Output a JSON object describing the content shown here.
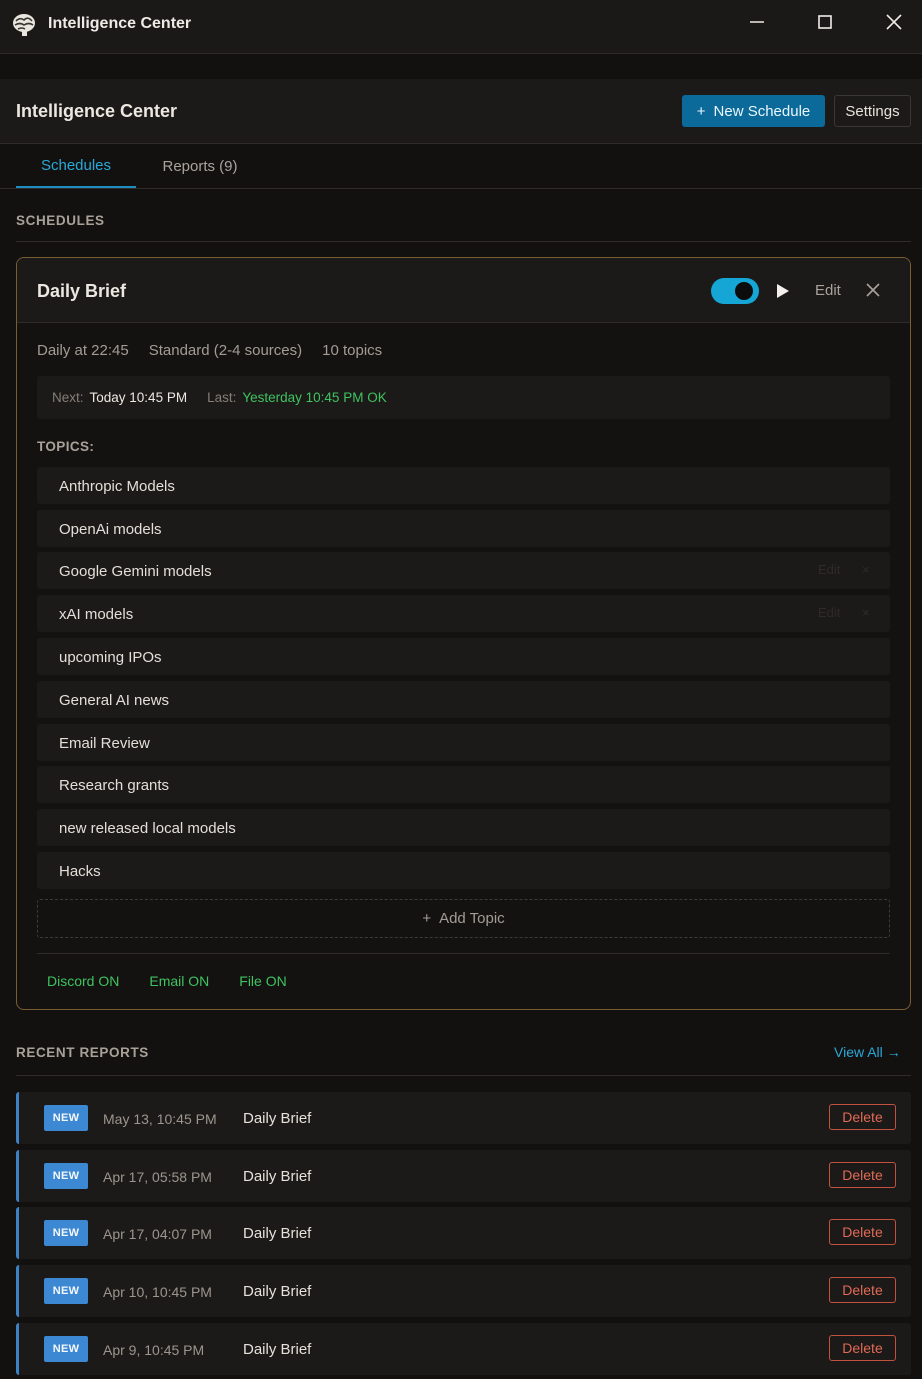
{
  "window": {
    "title": "Intelligence Center",
    "icon": "brain-icon"
  },
  "header": {
    "title": "Intelligence Center",
    "new_schedule_label": "New Schedule",
    "new_schedule_prefix": "+",
    "settings_label": "Settings"
  },
  "tabs": [
    {
      "label": "Schedules",
      "active": true
    },
    {
      "label": "Reports (9)",
      "active": false
    }
  ],
  "schedules_section": {
    "label": "SCHEDULES"
  },
  "schedule": {
    "title": "Daily Brief",
    "enabled": true,
    "edit_label": "Edit",
    "frequency": "Daily at 22:45",
    "depth": "Standard (2-4 sources)",
    "topic_count": "10 topics",
    "next_label": "Next:",
    "next_value": "Today 10:45 PM",
    "last_label": "Last:",
    "last_value": "Yesterday 10:45 PM OK",
    "topics_label": "TOPICS:",
    "topics": [
      {
        "label": "Anthropic Models"
      },
      {
        "label": "OpenAi models"
      },
      {
        "label": "Google Gemini models",
        "edit": "Edit",
        "remove": "×"
      },
      {
        "label": "xAI models",
        "edit": "Edit",
        "remove": "×"
      },
      {
        "label": "upcoming IPOs"
      },
      {
        "label": "General AI news"
      },
      {
        "label": "Email Review"
      },
      {
        "label": "Research grants"
      },
      {
        "label": "new released local models"
      },
      {
        "label": "Hacks"
      }
    ],
    "add_topic_prefix": "+",
    "add_topic_label": "Add Topic",
    "channels": [
      {
        "label": "Discord ON"
      },
      {
        "label": "Email ON"
      },
      {
        "label": "File ON"
      }
    ]
  },
  "recent_reports": {
    "label": "RECENT REPORTS",
    "view_all_label": "View All",
    "view_all_arrow": "→",
    "items": [
      {
        "badge": "NEW",
        "date": "May 13, 10:45 PM",
        "name": "Daily Brief",
        "delete_label": "Delete"
      },
      {
        "badge": "NEW",
        "date": "Apr 17, 05:58 PM",
        "name": "Daily Brief",
        "delete_label": "Delete"
      },
      {
        "badge": "NEW",
        "date": "Apr 17, 04:07 PM",
        "name": "Daily Brief",
        "delete_label": "Delete"
      },
      {
        "badge": "NEW",
        "date": "Apr 10, 10:45 PM",
        "name": "Daily Brief",
        "delete_label": "Delete"
      },
      {
        "badge": "NEW",
        "date": "Apr 9, 10:45 PM",
        "name": "Daily Brief",
        "delete_label": "Delete"
      }
    ]
  },
  "colors": {
    "accent": "#1e8fc0",
    "primary_button": "#0b6a99",
    "success": "#3ec35f",
    "danger": "#e06a55",
    "card_border": "#7a5d32",
    "badge": "#3c88d2"
  }
}
